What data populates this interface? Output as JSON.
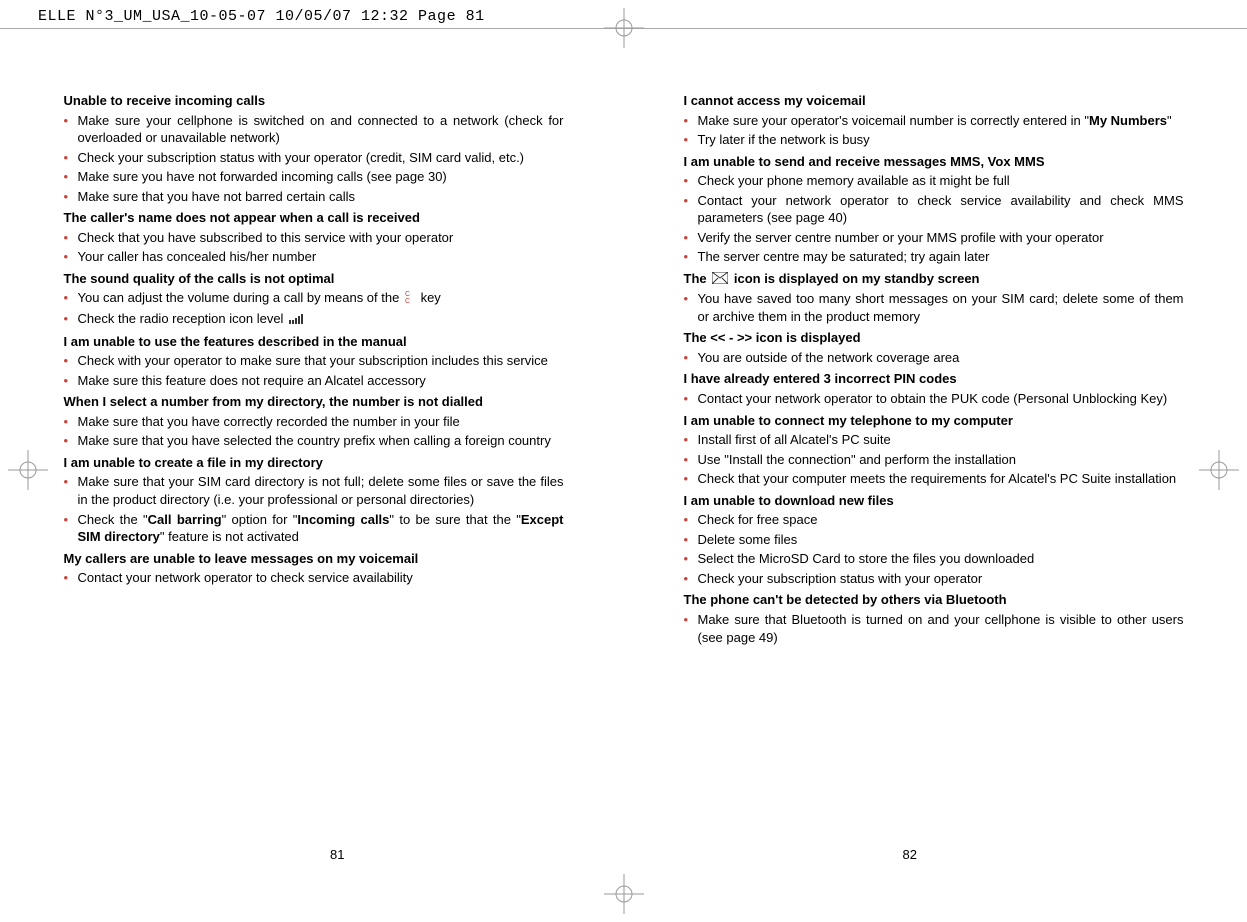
{
  "header": {
    "text": "ELLE N°3_UM_USA_10-05-07  10/05/07  12:32  Page 81"
  },
  "left": {
    "sections": [
      {
        "heading": "Unable to receive incoming calls",
        "items": [
          "Make sure your cellphone is switched on and connected to a network (check for overloaded or unavailable network)",
          "Check your subscription status with your operator (credit, SIM card valid, etc.)",
          "Make sure you have not forwarded incoming calls (see page 30)",
          "Make sure that you have not barred certain calls"
        ]
      },
      {
        "heading": "The caller's name does not appear when a call is received",
        "items": [
          "Check that you have subscribed to this service with your operator",
          "Your caller has concealed his/her number"
        ]
      },
      {
        "heading": "The sound quality of the calls is not optimal",
        "items_raw": [
          {
            "type": "volume"
          },
          {
            "type": "reception"
          }
        ],
        "volume_pre": "You can adjust the volume during a call by means of the ",
        "volume_post": " key",
        "reception_pre": "Check the radio reception icon level "
      },
      {
        "heading": "I am unable to use the features described in the manual",
        "items": [
          "Check with your operator to make sure that your subscription includes this service",
          "Make sure this feature does not require an Alcatel accessory"
        ]
      },
      {
        "heading": "When I select a number from my directory, the number is not dialled",
        "items": [
          "Make sure that you have correctly recorded the number in your file",
          "Make sure that you have selected the country prefix when calling a foreign country"
        ]
      },
      {
        "heading": "I am unable to create a file in my directory",
        "items": [
          "Make sure that your SIM card directory is not full; delete some files or save the files in the product directory (i.e. your professional or personal directories)"
        ],
        "callbarring_parts": {
          "p1": "Check the \"",
          "b1": "Call barring",
          "p2": "\" option for \"",
          "b2": "Incoming calls",
          "p3": "\" to be sure that the \"",
          "b3": "Except SIM directory",
          "p4": "\" feature is not activated"
        }
      },
      {
        "heading": "My callers are unable to leave messages on my voicemail",
        "items": [
          "Contact your network operator to check service availability"
        ]
      }
    ],
    "pagenum": "81"
  },
  "right": {
    "sections": [
      {
        "heading": "I cannot access my voicemail",
        "voicemail_parts": {
          "p1": "Make sure your operator's voicemail number is correctly entered in \"",
          "b1": "My Numbers",
          "p2": "\""
        },
        "items": [
          "Try later if the network is busy"
        ]
      },
      {
        "heading": "I am unable to send and receive messages MMS, Vox MMS",
        "items": [
          "Check your phone memory available as it might be full",
          "Contact your network operator to check service availability and check MMS parameters (see page 40)",
          "Verify the server centre number or your MMS profile with your operator",
          "The server centre may be saturated; try again later"
        ]
      },
      {
        "heading_parts": {
          "p1": "The ",
          "p2": " icon is displayed on my standby screen"
        },
        "items": [
          "You have saved too many short messages on your SIM card; delete some of them or archive them in the product memory"
        ]
      },
      {
        "heading": "The << - >> icon is displayed",
        "items": [
          "You are outside of the network coverage area"
        ]
      },
      {
        "heading": "I have already entered 3 incorrect PIN codes",
        "items": [
          "Contact your network operator to obtain the PUK code (Personal Unblocking Key)"
        ]
      },
      {
        "heading": "I am unable to connect my telephone to my computer",
        "items": [
          "Install first of all Alcatel's PC suite",
          "Use \"Install the connection\" and perform the installation",
          "Check that your computer meets the requirements for Alcatel's PC Suite installation"
        ]
      },
      {
        "heading": "I am unable to download new files",
        "items": [
          "Check for free space",
          "Delete some files",
          "Select the MicroSD Card to store the files you downloaded",
          "Check your subscription status with your operator"
        ]
      },
      {
        "heading": "The phone can't be detected by others via Bluetooth",
        "items": [
          "Make sure that Bluetooth is turned on and your cellphone is visible to other users (see page 49)"
        ]
      }
    ],
    "pagenum": "82"
  }
}
